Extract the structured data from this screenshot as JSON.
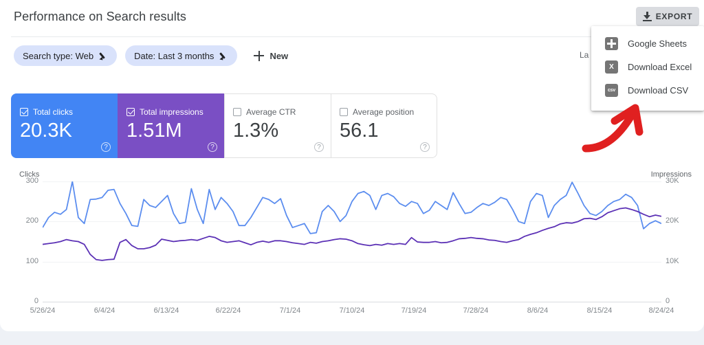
{
  "header": {
    "title": "Performance on Search results",
    "export_label": "EXPORT",
    "download_icon": "download-icon"
  },
  "filters": {
    "chips": [
      {
        "label": "Search type: Web",
        "edit_icon": "pencil-icon"
      },
      {
        "label": "Date: Last 3 months",
        "edit_icon": "pencil-icon"
      }
    ],
    "new_label": "New",
    "add_icon": "plus-icon",
    "last_updated_partial": "La"
  },
  "metric_cards": [
    {
      "name": "Total clicks",
      "value": "20.3K",
      "checked": true,
      "color": "#4285f4",
      "help_icon": "help-icon"
    },
    {
      "name": "Total impressions",
      "value": "1.51M",
      "checked": true,
      "color": "#7a4fc4",
      "help_icon": "help-icon"
    },
    {
      "name": "Average CTR",
      "value": "1.3%",
      "checked": false,
      "color": "#ffffff",
      "help_icon": "help-icon"
    },
    {
      "name": "Average position",
      "value": "56.1",
      "checked": false,
      "color": "#ffffff",
      "help_icon": "help-icon"
    }
  ],
  "export_menu": {
    "items": [
      {
        "label": "Google Sheets",
        "icon": "google-sheets-icon",
        "glyph": ""
      },
      {
        "label": "Download Excel",
        "icon": "excel-icon",
        "glyph": "X"
      },
      {
        "label": "Download CSV",
        "icon": "csv-icon",
        "glyph": "csv"
      }
    ]
  },
  "annotation": {
    "arrow_color": "#e02020",
    "points_to": "Download CSV"
  },
  "chart_data": {
    "type": "line",
    "title": "",
    "xlabel": "",
    "grid": true,
    "legend": "none",
    "axes": {
      "left": {
        "label": "Clicks",
        "ticks": [
          "0",
          "100",
          "200",
          "300"
        ],
        "ylim": [
          0,
          300
        ]
      },
      "right": {
        "label": "Impressions",
        "ticks": [
          "0",
          "10K",
          "20K",
          "30K"
        ],
        "ylim": [
          0,
          30000
        ]
      }
    },
    "tick_labels": [
      "5/26/24",
      "6/4/24",
      "6/13/24",
      "6/22/24",
      "7/1/24",
      "7/10/24",
      "7/19/24",
      "7/28/24",
      "8/6/24",
      "8/15/24",
      "8/24/24"
    ],
    "series": [
      {
        "name": "Total impressions",
        "color": "#5b8def",
        "axis": "right",
        "unit": "impressions",
        "values": [
          18500,
          21000,
          22300,
          21800,
          23000,
          30000,
          21000,
          19500,
          25500,
          25600,
          26000,
          27800,
          28000,
          24500,
          22000,
          19000,
          18800,
          25500,
          24000,
          23500,
          25000,
          26500,
          22000,
          19500,
          19800,
          28200,
          23000,
          19500,
          28000,
          23000,
          26000,
          24500,
          22500,
          19000,
          19000,
          21000,
          23500,
          26000,
          25500,
          24500,
          25700,
          21500,
          18500,
          19000,
          19500,
          17000,
          17200,
          22500,
          24000,
          22500,
          20000,
          21500,
          25000,
          27000,
          27500,
          26500,
          23000,
          26500,
          27000,
          26200,
          24500,
          23800,
          25000,
          24500,
          22000,
          22800,
          25000,
          24000,
          23000,
          27200,
          24500,
          22000,
          22300,
          23500,
          24500,
          24000,
          24800,
          26000,
          25500,
          23000,
          20000,
          19500,
          25000,
          27000,
          26500,
          21000,
          24000,
          25500,
          26500,
          29800,
          27000,
          24000,
          22000,
          21500,
          22500,
          24000,
          25000,
          25500,
          26800,
          26000,
          24000,
          18200,
          19500,
          20200,
          19500
        ]
      },
      {
        "name": "Total clicks",
        "color": "#5b30b5",
        "axis": "left",
        "unit": "clicks",
        "values": [
          143,
          145,
          147,
          150,
          155,
          152,
          150,
          143,
          118,
          105,
          103,
          105,
          106,
          148,
          155,
          140,
          132,
          132,
          135,
          141,
          156,
          153,
          150,
          152,
          153,
          155,
          153,
          158,
          163,
          160,
          152,
          148,
          150,
          152,
          147,
          142,
          148,
          151,
          148,
          152,
          152,
          150,
          147,
          145,
          143,
          148,
          146,
          150,
          152,
          155,
          157,
          156,
          152,
          145,
          142,
          140,
          143,
          141,
          145,
          143,
          145,
          143,
          160,
          149,
          148,
          148,
          150,
          147,
          148,
          152,
          157,
          158,
          160,
          158,
          157,
          154,
          153,
          150,
          148,
          152,
          155,
          163,
          168,
          172,
          178,
          183,
          187,
          194,
          197,
          196,
          200,
          207,
          208,
          205,
          212,
          222,
          227,
          232,
          234,
          230,
          225,
          218,
          212,
          216,
          213
        ]
      }
    ]
  }
}
